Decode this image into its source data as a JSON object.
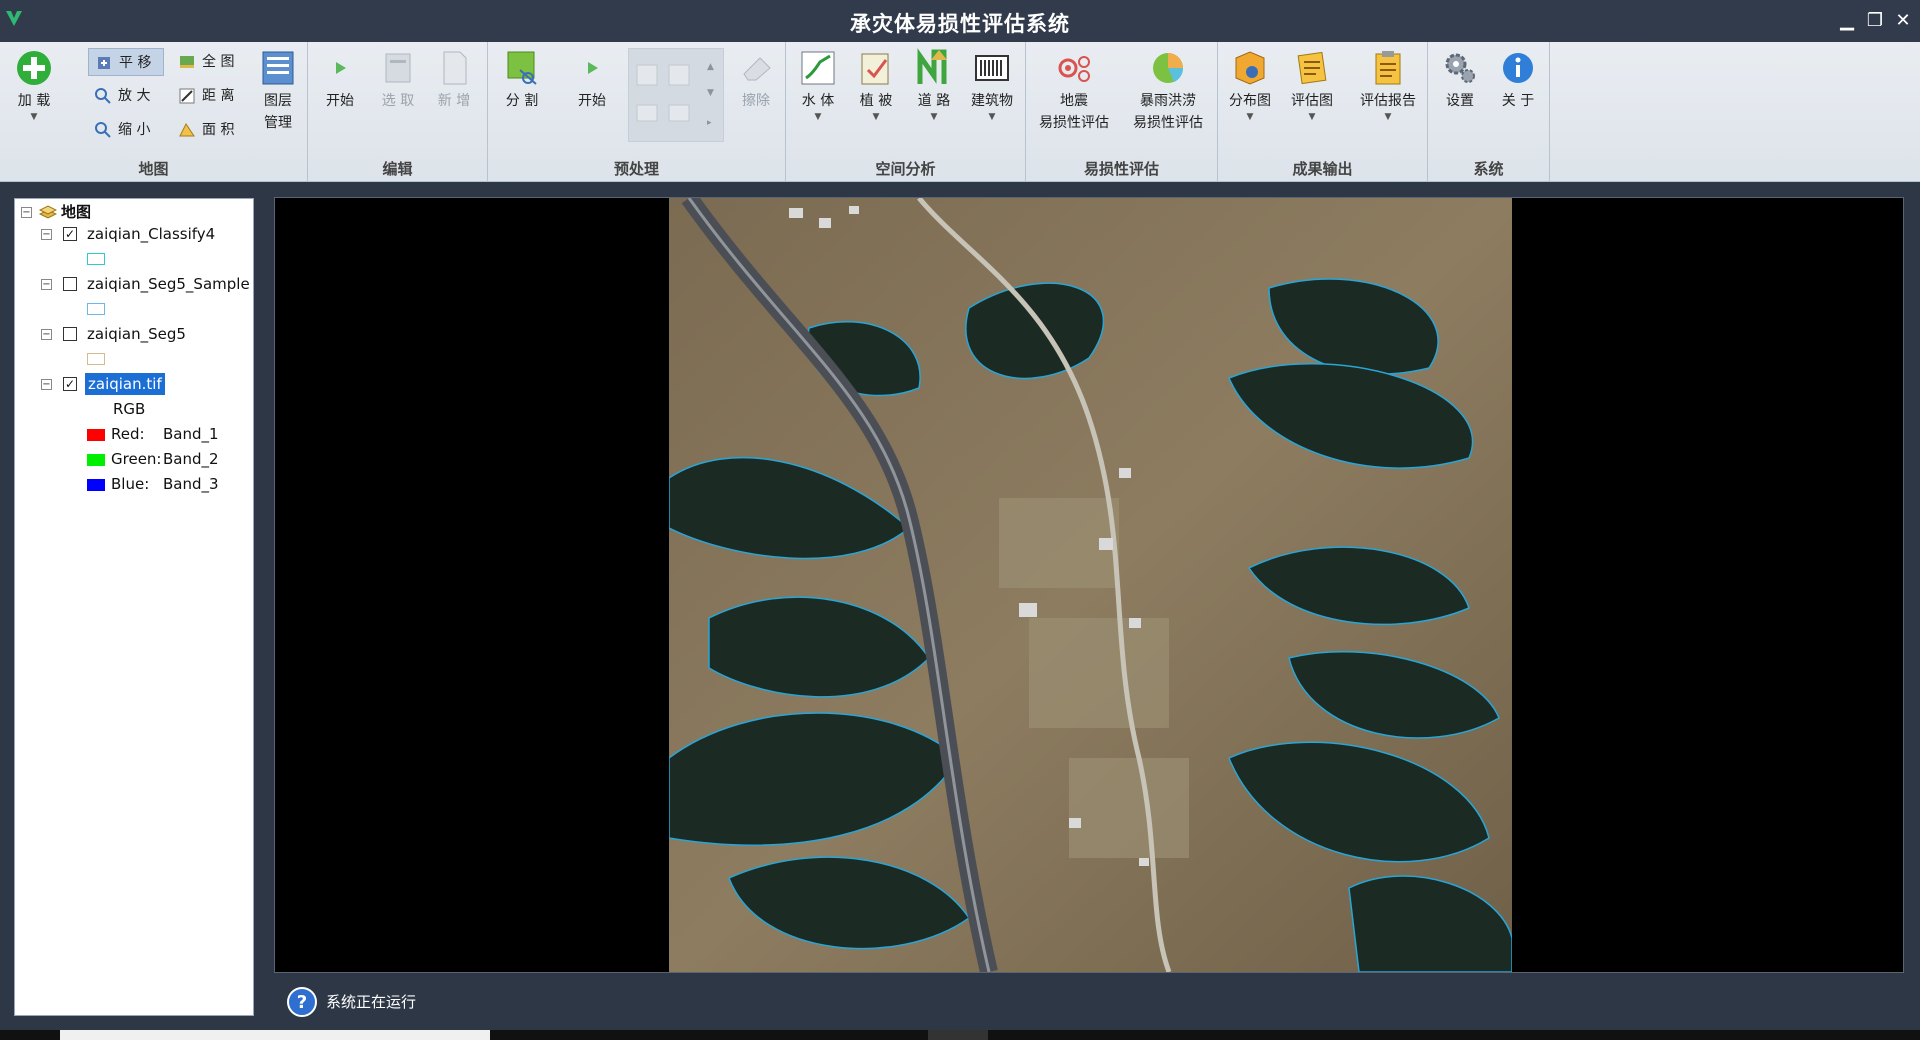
{
  "app": {
    "title": "承灾体易损性评估系统",
    "window_controls": {
      "minimize": "▁",
      "restore": "❐",
      "close": "✕"
    }
  },
  "ribbon": {
    "groups": {
      "map": "地图",
      "edit": "编辑",
      "preprocess": "预处理",
      "spatial": "空间分析",
      "vuln": "易损性评估",
      "output": "成果输出",
      "system": "系统"
    },
    "load": "加 载",
    "pan": "平 移",
    "zoom_in": "放 大",
    "zoom_out": "缩 小",
    "full_extent": "全 图",
    "distance": "距 离",
    "area": "面 积",
    "layer_mgr_1": "图层",
    "layer_mgr_2": "管理",
    "edit_start": "开始",
    "select": "选 取",
    "add": "新 增",
    "segment": "分 割",
    "pre_start": "开始",
    "erase": "擦除",
    "water": "水 体",
    "vegetation": "植 被",
    "road": "道 路",
    "building": "建筑物",
    "quake_1": "地震",
    "quake_2": "易损性评估",
    "flood_1": "暴雨洪涝",
    "flood_2": "易损性评估",
    "dist_map": "分布图",
    "eval_map": "评估图",
    "eval_report": "评估报告",
    "settings": "设置",
    "about": "关 于"
  },
  "layers": {
    "root": "地图",
    "items": [
      {
        "name": "zaiqian_Classify4",
        "checked": true,
        "swatch": "#2ec9d6"
      },
      {
        "name": "zaiqian_Seg5_Sample",
        "checked": false,
        "swatch": "#6fb6e8"
      },
      {
        "name": "zaiqian_Seg5",
        "checked": false,
        "swatch": "#d9b98f"
      },
      {
        "name": "zaiqian.tif",
        "checked": true
      }
    ],
    "rgb_label": "RGB",
    "bands": [
      {
        "label": "Red:",
        "band": "Band_1",
        "color": "#ff0000"
      },
      {
        "label": "Green:",
        "band": "Band_2",
        "color": "#00ee00"
      },
      {
        "label": "Blue:",
        "band": "Band_3",
        "color": "#0000ff"
      }
    ],
    "check_mark": "✓",
    "expand_mark": "−"
  },
  "status": {
    "text": "系统正在运行"
  }
}
